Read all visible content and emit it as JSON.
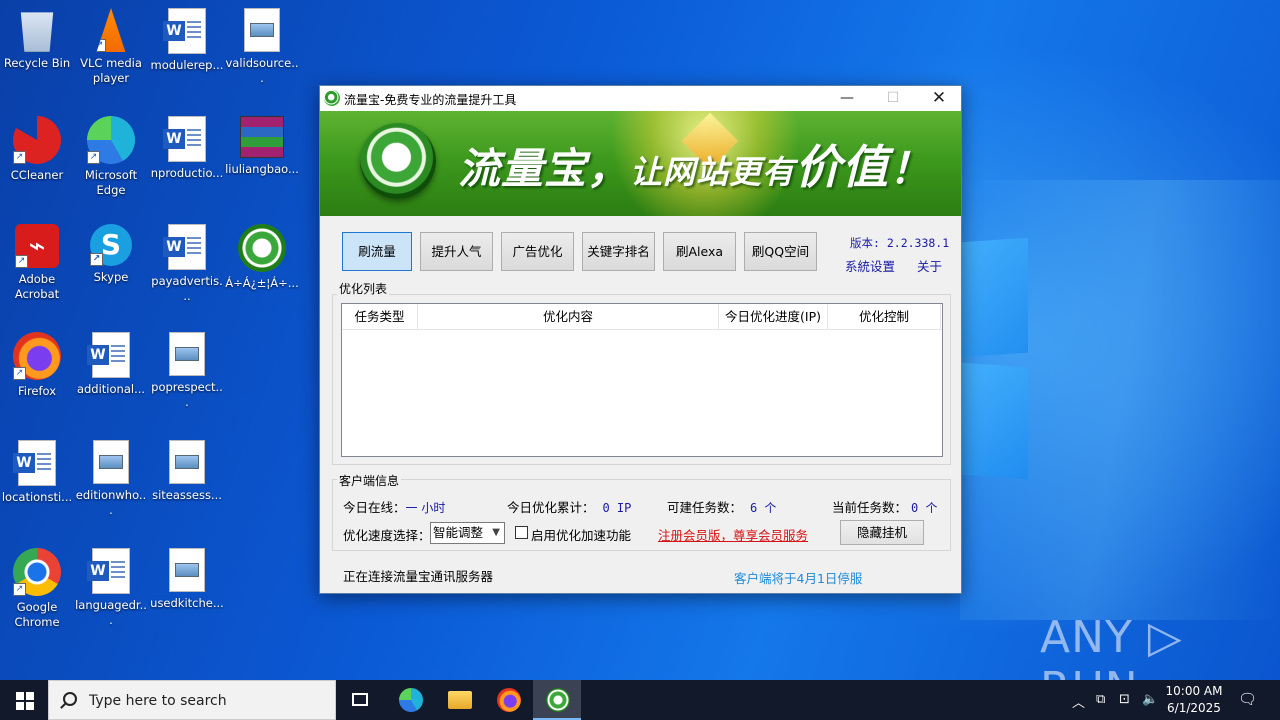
{
  "desktop": {
    "icons": [
      {
        "label": "Recycle Bin"
      },
      {
        "label": "VLC media player"
      },
      {
        "label": "modulerep..."
      },
      {
        "label": "validsource..."
      },
      {
        "label": "CCleaner"
      },
      {
        "label": "Microsoft Edge"
      },
      {
        "label": "nproductio..."
      },
      {
        "label": "liuliangbao..."
      },
      {
        "label": "Adobe Acrobat"
      },
      {
        "label": "Skype"
      },
      {
        "label": "payadvertis..."
      },
      {
        "label": "Á÷Á¿±¦Á÷..."
      },
      {
        "label": "Firefox"
      },
      {
        "label": "additional..."
      },
      {
        "label": "poprespect..."
      },
      {
        "label": "locationsti..."
      },
      {
        "label": "editionwho..."
      },
      {
        "label": "siteassess..."
      },
      {
        "label": "Google Chrome"
      },
      {
        "label": "languagedr..."
      },
      {
        "label": "usedkitche..."
      }
    ]
  },
  "window": {
    "title": "流量宝-免费专业的流量提升工具",
    "min_glyph": "—",
    "max_glyph": "☐",
    "close_glyph": "✕",
    "banner": {
      "slogan_a": "流量宝，",
      "slogan_b": "让网站更有",
      "slogan_c": "价值",
      "slogan_d": "！"
    },
    "tabs": [
      {
        "label": "刷流量"
      },
      {
        "label": "提升人气"
      },
      {
        "label": "广告优化"
      },
      {
        "label": "关键字排名"
      },
      {
        "label": "刷Alexa"
      },
      {
        "label": "刷QQ空间"
      }
    ],
    "version": "版本: 2.2.338.1",
    "settings_link": "系統设置",
    "about_link": "关于",
    "opt_list": {
      "title": "优化列表",
      "columns": [
        "任务类型",
        "优化内容",
        "今日优化进度(IP)",
        "优化控制"
      ]
    },
    "client_info": {
      "title": "客户端信息",
      "online_label": "今日在线：",
      "online_value": "一 小时",
      "total_label": "今日优化累计：",
      "total_value": "0 IP",
      "creatable_label": "可建任务数：",
      "creatable_value": "6 个",
      "current_label": "当前任务数：",
      "current_value": "0 个",
      "speed_label": "优化速度选择：",
      "speed_value": "智能调整",
      "accel_label": "启用优化加速功能",
      "register_link": "注册会员版，尊享会员服务",
      "hide_button": "隐藏挂机"
    },
    "status_left": "正在连接流量宝通讯服务器",
    "status_right": "客户端将于4月1日停服"
  },
  "watermark": "ANY ▷ RUN",
  "taskbar": {
    "search_placeholder": "Type here to search",
    "time": "10:00 AM",
    "date": "6/1/2025"
  }
}
